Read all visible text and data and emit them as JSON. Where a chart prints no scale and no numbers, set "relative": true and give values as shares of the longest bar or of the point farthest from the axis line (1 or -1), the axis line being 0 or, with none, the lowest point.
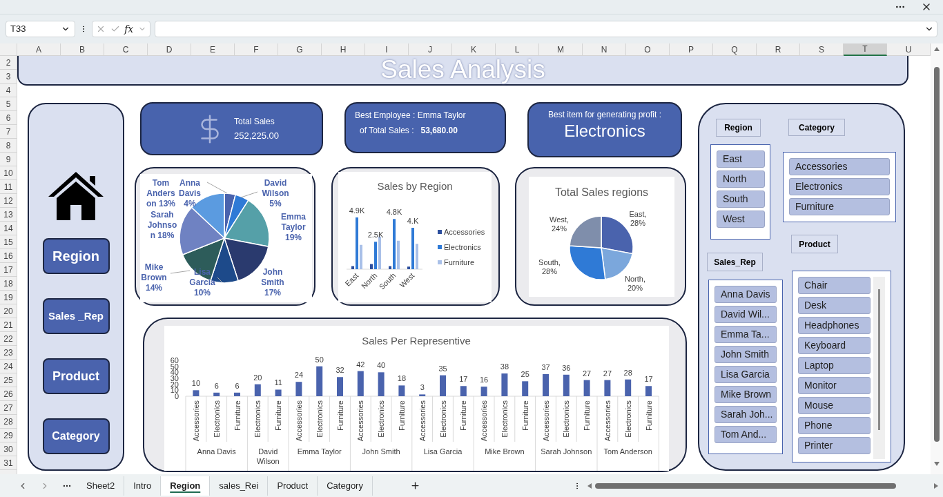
{
  "formula_bar": {
    "name_box": "T33",
    "function_label": "fx"
  },
  "columns": [
    {
      "label": "A",
      "selected": false
    },
    {
      "label": "B",
      "selected": false
    },
    {
      "label": "C",
      "selected": false
    },
    {
      "label": "D",
      "selected": false
    },
    {
      "label": "E",
      "selected": false
    },
    {
      "label": "F",
      "selected": false
    },
    {
      "label": "G",
      "selected": false
    },
    {
      "label": "H",
      "selected": false
    },
    {
      "label": "I",
      "selected": false
    },
    {
      "label": "J",
      "selected": false
    },
    {
      "label": "K",
      "selected": false
    },
    {
      "label": "L",
      "selected": false
    },
    {
      "label": "M",
      "selected": false
    },
    {
      "label": "N",
      "selected": false
    },
    {
      "label": "O",
      "selected": false
    },
    {
      "label": "P",
      "selected": false
    },
    {
      "label": "Q",
      "selected": false
    },
    {
      "label": "R",
      "selected": false
    },
    {
      "label": "S",
      "selected": false
    },
    {
      "label": "T",
      "selected": true
    },
    {
      "label": "U",
      "selected": false
    }
  ],
  "rows": [
    "2",
    "3",
    "4",
    "5",
    "6",
    "7",
    "8",
    "9",
    "10",
    "11",
    "12",
    "13",
    "14",
    "15",
    "16",
    "17",
    "18",
    "19",
    "20",
    "21",
    "22",
    "23",
    "24",
    "25",
    "26",
    "27",
    "28",
    "29",
    "30",
    "31"
  ],
  "dashboard": {
    "title": "Sales Analysis",
    "nav_buttons": [
      "Region",
      "Sales _Rep",
      "Product",
      "Category"
    ],
    "kpis": [
      {
        "kind": "total",
        "label": "Total Sales",
        "value": "252,225.00"
      },
      {
        "kind": "employee",
        "label": "Best Employee : Emma Taylor",
        "sublabel": "of Total Sales :",
        "value": "53,680.00"
      },
      {
        "kind": "item",
        "label": "Best item for generating profit :",
        "value": "Electronics"
      }
    ],
    "rep_share_chart": {
      "chart_data": {
        "type": "pie",
        "categories": [
          "Anna Davis",
          "David Wilson",
          "Emma Taylor",
          "John Smith",
          "Lisa Garcia",
          "Mike Brown",
          "Sarah Johnson",
          "Tom Anderson"
        ],
        "series": [
          {
            "values": [
              4,
              5,
              19,
              17,
              10,
              14,
              18,
              13
            ]
          }
        ],
        "colors": [
          "#4a63ad",
          "#2f7ad6",
          "#55a0a8",
          "#2a3a6e",
          "#1d4a8a",
          "#2d5c5a",
          "#6f82c2",
          "#5b9be0"
        ],
        "value_labels": [
          "4%",
          "5%",
          "19%",
          "17%",
          "10%",
          "14%",
          "18%",
          "13%"
        ]
      }
    },
    "region_bar_chart": {
      "chart_data": {
        "type": "bar",
        "title": "Sales by Region",
        "categories": [
          "East",
          "North",
          "South",
          "West"
        ],
        "series": [
          {
            "name": "Accessories",
            "color": "#2d4f9e",
            "values": [
              0.06,
              0.1,
              0.06,
              0.05
            ]
          },
          {
            "name": "Electronics",
            "color": "#2f7ad6",
            "values": [
              1,
              0.53,
              0.97,
              0.8
            ]
          },
          {
            "name": "Furniture",
            "color": "#a9c0e8",
            "values": [
              0.47,
              0.63,
              0.55,
              0.49
            ]
          }
        ],
        "value_labels": [
          "4.9K",
          "2.5K",
          "4.8K",
          "4.K"
        ],
        "legend": "right",
        "relative": true
      }
    },
    "region_share_chart": {
      "label_separator": ",",
      "chart_data": {
        "type": "pie",
        "title": "Total Sales regions",
        "categories": [
          "East",
          "North",
          "South",
          "West"
        ],
        "series": [
          {
            "values": [
              28,
              20,
              28,
              24
            ]
          }
        ],
        "colors": [
          "#4a63ad",
          "#7ba7dc",
          "#2f7ad6",
          "#7f8eab"
        ],
        "value_labels": [
          "28%",
          "20%",
          "28%",
          "24%"
        ]
      }
    },
    "rep_sales_chart": {
      "groups": [
        {
          "label": "Anna Davis",
          "categories": [
            "Accessories",
            "Electronics",
            "Furniture"
          ]
        },
        {
          "label": "David Wilson",
          "categories": [
            "Electronics",
            "Furniture"
          ]
        },
        {
          "label": "Emma Taylor",
          "categories": [
            "Accessories",
            "Electronics",
            "Furniture"
          ]
        },
        {
          "label": "John Smith",
          "categories": [
            "Accessories",
            "Electronics",
            "Furniture"
          ]
        },
        {
          "label": "Lisa Garcia",
          "categories": [
            "Accessories",
            "Electronics",
            "Furniture"
          ]
        },
        {
          "label": "Mike Brown",
          "categories": [
            "Accessories",
            "Electronics",
            "Furniture"
          ]
        },
        {
          "label": "Sarah Johnson",
          "categories": [
            "Accessories",
            "Electronics",
            "Furniture"
          ]
        },
        {
          "label": "Tom Anderson",
          "categories": [
            "Accessories",
            "Electronics",
            "Furniture"
          ]
        }
      ],
      "chart_data": {
        "type": "bar",
        "title": "Sales Per Representive",
        "series": [
          {
            "color": "#4a63ad",
            "values": [
              10,
              6,
              6,
              20,
              11,
              24,
              50,
              32,
              42,
              40,
              18,
              3,
              35,
              17,
              16,
              38,
              25,
              37,
              36,
              27,
              27,
              28,
              17
            ]
          }
        ],
        "ylim": [
          0,
          60
        ],
        "yticks": [
          0,
          10,
          20,
          30,
          40,
          50,
          60
        ],
        "data_labels": true
      }
    },
    "slicers": [
      {
        "title": "Region",
        "items": [
          {
            "label": "East",
            "selected": true
          },
          {
            "label": "North",
            "selected": true
          },
          {
            "label": "South",
            "selected": true
          },
          {
            "label": "West",
            "selected": true
          }
        ]
      },
      {
        "title": "Category",
        "items": [
          {
            "label": "Accessories",
            "selected": true
          },
          {
            "label": "Electronics",
            "selected": true
          },
          {
            "label": "Furniture",
            "selected": true
          }
        ]
      },
      {
        "title": "Sales_Rep",
        "items": [
          {
            "label": "Anna Davis",
            "selected": true
          },
          {
            "label": "David Wil...",
            "selected": true
          },
          {
            "label": "Emma Ta...",
            "selected": true
          },
          {
            "label": "John Smith",
            "selected": true
          },
          {
            "label": "Lisa Garcia",
            "selected": true
          },
          {
            "label": "Mike Brown",
            "selected": true
          },
          {
            "label": "Sarah Joh...",
            "selected": true
          },
          {
            "label": "Tom And...",
            "selected": true
          }
        ]
      },
      {
        "title": "Product",
        "items": [
          {
            "label": "Chair",
            "selected": true
          },
          {
            "label": "Desk",
            "selected": true
          },
          {
            "label": "Headphones",
            "selected": true
          },
          {
            "label": "Keyboard",
            "selected": true
          },
          {
            "label": "Laptop",
            "selected": true
          },
          {
            "label": "Monitor",
            "selected": true
          },
          {
            "label": "Mouse",
            "selected": true
          },
          {
            "label": "Phone",
            "selected": true
          },
          {
            "label": "Printer",
            "selected": true
          }
        ]
      }
    ]
  },
  "sheet_tabs": [
    {
      "label": "Sheet2",
      "selected": false
    },
    {
      "label": "Intro",
      "selected": false
    },
    {
      "label": "Region",
      "selected": true
    },
    {
      "label": "sales_Rei",
      "selected": false
    },
    {
      "label": "Product",
      "selected": false
    },
    {
      "label": "Category",
      "selected": false
    }
  ]
}
